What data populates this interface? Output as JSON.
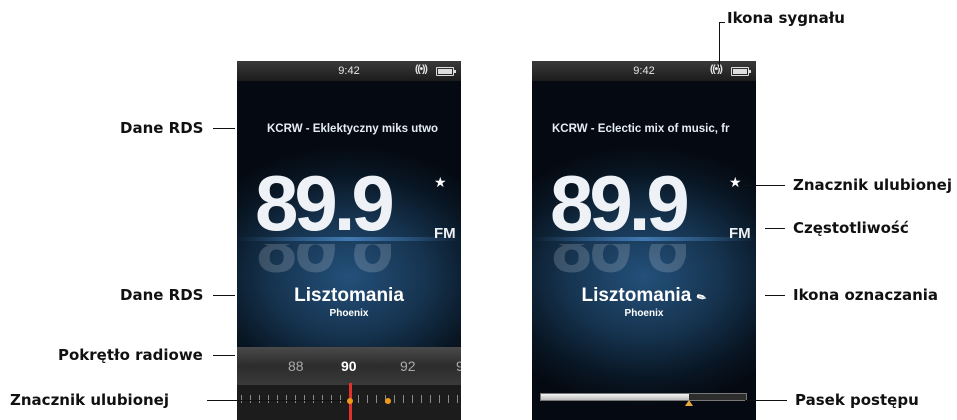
{
  "callouts": {
    "rds_top": "Dane RDS",
    "rds_mid": "Dane RDS",
    "dial": "Pokrętło radiowe",
    "fav_marker_left": "Znacznik ulubionej",
    "signal": "Ikona sygnału",
    "fav_marker_right": "Znacznik ulubionej",
    "frequency": "Częstotliwość",
    "tag": "Ikona oznaczania",
    "progress": "Pasek postępu"
  },
  "left_screen": {
    "time": "9:42",
    "signal_glyph": "((•))",
    "rds_text": "KCRW - Eklektyczny miks utwo",
    "frequency": "89.9",
    "band": "FM",
    "favorite_glyph": "★",
    "song": "Lisztomania",
    "artist": "Phoenix",
    "dial_numbers": [
      "88",
      "90",
      "92",
      "9"
    ]
  },
  "right_screen": {
    "time": "9:42",
    "signal_glyph": "((•))",
    "rds_text": "KCRW - Eclectic mix of music, fr",
    "frequency": "89.9",
    "band": "FM",
    "favorite_glyph": "★",
    "song": "Lisztomania",
    "artist": "Phoenix",
    "tag_glyph": "✎",
    "progress_fraction": 0.72
  }
}
